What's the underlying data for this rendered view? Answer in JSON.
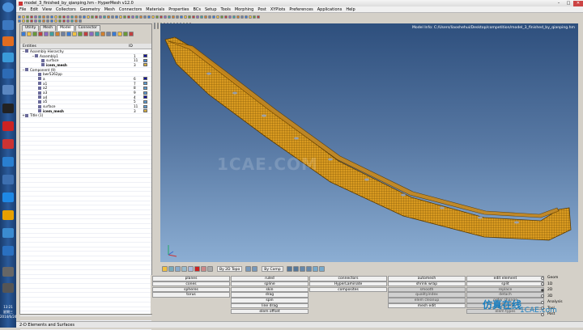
{
  "window": {
    "title": "model_3_finished_by_qianping.hm - HyperMesh v12.0"
  },
  "menu": [
    "File",
    "Edit",
    "View",
    "Collectors",
    "Geometry",
    "Mesh",
    "Connectors",
    "Materials",
    "Properties",
    "BCs",
    "Setup",
    "Tools",
    "Morphing",
    "Post",
    "XYPlots",
    "Preferences",
    "Applications",
    "Help"
  ],
  "tabs": [
    "Utility",
    "Mesh",
    "Model",
    "Connector"
  ],
  "entities": {
    "header": {
      "name": "Entities",
      "id": "ID",
      "color": ""
    },
    "rows": [
      {
        "name": "Assembly Hierarchy",
        "id": "",
        "exp": "−",
        "indent": 2,
        "sw": ""
      },
      {
        "name": "Assembly1",
        "id": "1",
        "exp": "−",
        "indent": 14,
        "sw": "#1010a0"
      },
      {
        "name": "surface",
        "id": "11",
        "exp": "",
        "indent": 22,
        "sw": "#4a8ad0"
      },
      {
        "name": "icem_mesh",
        "id": "3",
        "exp": "",
        "indent": 22,
        "sw": "#d9b040",
        "bold": true
      },
      {
        "name": "Component (9)",
        "id": "",
        "exp": "−",
        "indent": 2,
        "sw": ""
      },
      {
        "name": "bwr5262pp",
        "id": "",
        "exp": "",
        "indent": 18,
        "sw": ""
      },
      {
        "name": "a",
        "id": "6",
        "exp": "",
        "indent": 18,
        "sw": "#1010a0"
      },
      {
        "name": "a1",
        "id": "7",
        "exp": "",
        "indent": 18,
        "sw": "#5b9bd5"
      },
      {
        "name": "a2",
        "id": "8",
        "exp": "",
        "indent": 18,
        "sw": "#5b9bd5"
      },
      {
        "name": "a3",
        "id": "9",
        "exp": "",
        "indent": 18,
        "sw": "#5b9bd5"
      },
      {
        "name": "a4",
        "id": "4",
        "exp": "",
        "indent": 18,
        "sw": "#1010a0"
      },
      {
        "name": "a5",
        "id": "5",
        "exp": "",
        "indent": 18,
        "sw": "#5b9bd5"
      },
      {
        "name": "surface",
        "id": "11",
        "exp": "",
        "indent": 18,
        "sw": "#5b9bd5"
      },
      {
        "name": "icem_mesh",
        "id": "3",
        "exp": "",
        "indent": 18,
        "sw": "#d9b040",
        "bold": true
      },
      {
        "name": "Title (1)",
        "id": "",
        "exp": "+",
        "indent": 2,
        "sw": ""
      }
    ]
  },
  "viewport": {
    "model_info": "Model Info: C:/Users/liaoshehui/Desktop/competition/model_3_finished_by_qianping.hm",
    "watermark": "1CAE.COM"
  },
  "view_toolbar": {
    "by_topo": "By 2D Topo",
    "by_comp": "By Comp"
  },
  "panels": {
    "col1": [
      "planes",
      "cones",
      "spheres",
      "torus"
    ],
    "col2": [
      "ruled",
      "spline",
      "skin",
      "drag",
      "spin",
      "line drag",
      "elem offset"
    ],
    "col3": [
      "connectors",
      "HyperLaminate",
      "composites"
    ],
    "col4": [
      "automesh",
      "shrink wrap",
      "smooth",
      "qualityindex",
      "elem cleanup",
      "mesh edit"
    ],
    "col5": [
      "edit element",
      "split",
      "replace",
      "detach",
      "order change",
      "config edit",
      "elem types"
    ]
  },
  "radios": [
    {
      "label": "Geom",
      "on": false
    },
    {
      "label": "1D",
      "on": false
    },
    {
      "label": "2D",
      "on": true
    },
    {
      "label": "3D",
      "on": false
    },
    {
      "label": "Analysis",
      "on": false
    },
    {
      "label": "Tool",
      "on": false
    },
    {
      "label": "Post",
      "on": false
    }
  ],
  "status": "2-D Elements and Surfaces",
  "brand": {
    "main": "仿真在线",
    "sub": "1CAE.com"
  },
  "taskbar": {
    "time": "13:21",
    "day": "星期三",
    "date": "2014/6/24"
  },
  "colors": {
    "mesh": "#d99a20",
    "mesh_line": "#5a3a00"
  }
}
